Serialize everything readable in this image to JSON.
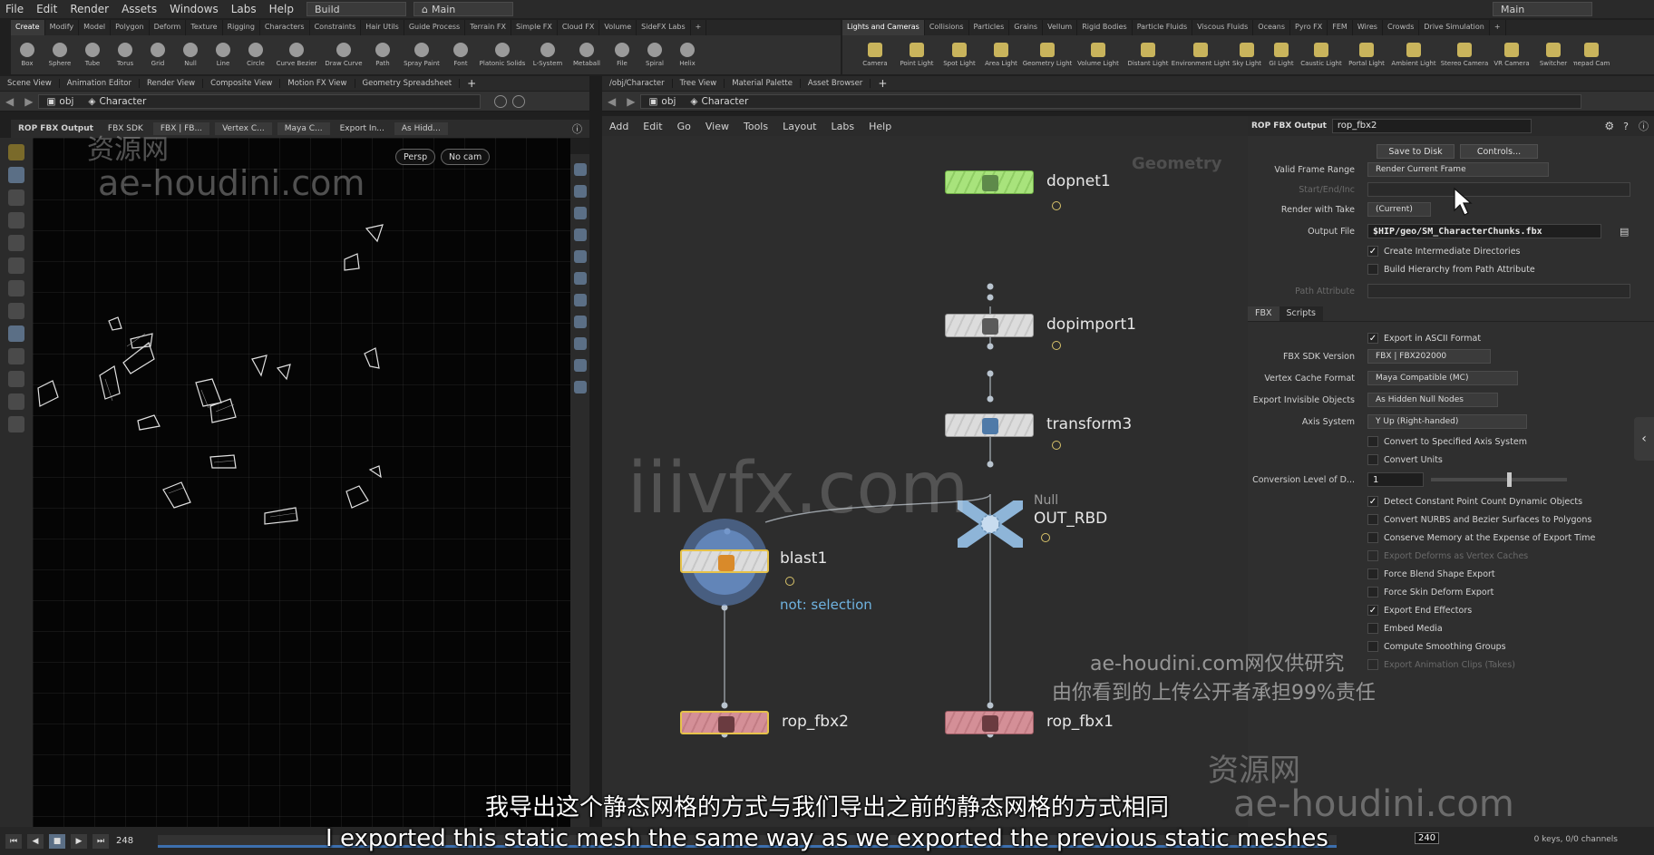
{
  "menubar": {
    "items": [
      "File",
      "Edit",
      "Render",
      "Assets",
      "Windows",
      "Labs",
      "Help"
    ],
    "desktop": "Build",
    "desk_icon": "house-icon",
    "context": "Main",
    "context_right": "Main"
  },
  "shelf_left": {
    "tabs": [
      "Create",
      "Modify",
      "Model",
      "Polygon",
      "Deform",
      "Texture",
      "Rigging",
      "Characters",
      "Constraints",
      "Hair Utils",
      "Guide Process",
      "Terrain FX",
      "Simple FX",
      "Cloud FX",
      "Volume",
      "SideFX Labs",
      "+"
    ],
    "tools": [
      "Box",
      "Sphere",
      "Tube",
      "Torus",
      "Grid",
      "Null",
      "Line",
      "Circle",
      "Curve Bezier",
      "Draw Curve",
      "Path",
      "Spray Paint",
      "Font",
      "Platonic Solids",
      "L-System",
      "Metaball",
      "File",
      "Spiral",
      "Helix"
    ]
  },
  "shelf_right": {
    "tabs": [
      "Lights and Cameras",
      "Collisions",
      "Particles",
      "Grains",
      "Vellum",
      "Rigid Bodies",
      "Particle Fluids",
      "Viscous Fluids",
      "Oceans",
      "Pyro FX",
      "FEM",
      "Wires",
      "Crowds",
      "Drive Simulation",
      "+"
    ],
    "tools": [
      "Camera",
      "Point Light",
      "Spot Light",
      "Area Light",
      "Geometry Light",
      "Volume Light",
      "Distant Light",
      "Environment Light",
      "Sky Light",
      "GI Light",
      "Caustic Light",
      "Portal Light",
      "Ambient Light",
      "Stereo Camera",
      "VR Camera",
      "Switcher",
      "Gamepad Camera"
    ]
  },
  "left_pane": {
    "tabs": [
      "Scene View",
      "Animation Editor",
      "Render View",
      "Composite View",
      "Motion FX View",
      "Geometry Spreadsheet",
      "+"
    ],
    "path": [
      "obj",
      "Character"
    ],
    "toolbar": [
      "ROP FBX Output",
      "FBX SDK",
      "FBX | FB...",
      "Vertex C...",
      "Maya C...",
      "Export In...",
      "As Hidd..."
    ],
    "persp": "Persp",
    "cam": "No cam"
  },
  "right_pane": {
    "tabs": [
      "/obj/Character",
      "Tree View",
      "Material Palette",
      "Asset Browser",
      "+"
    ],
    "path": [
      "obj",
      "Character"
    ],
    "menu": [
      "Add",
      "Edit",
      "Go",
      "View",
      "Tools",
      "Layout",
      "Labs",
      "Help"
    ]
  },
  "network": {
    "context_label": "Geometry",
    "nodes": {
      "dopnet": {
        "name": "dopnet1"
      },
      "dopimport": {
        "name": "dopimport1"
      },
      "transform": {
        "name": "transform3"
      },
      "null": {
        "name": "OUT_RBD",
        "type": "Null"
      },
      "blast": {
        "name": "blast1",
        "note": "not: selection"
      },
      "rop2": {
        "name": "rop_fbx2"
      },
      "rop1": {
        "name": "rop_fbx1"
      }
    }
  },
  "params": {
    "node_type": "ROP FBX Output",
    "node_name": "rop_fbx2",
    "save_to_disk": "Save to Disk",
    "controls": "Controls...",
    "valid_frame_range_label": "Valid Frame Range",
    "valid_frame_range": "Render Current Frame",
    "start_end_label": "Start/End/Inc",
    "render_with_take_label": "Render with Take",
    "render_with_take": "(Current)",
    "output_file_label": "Output File",
    "output_file": "$HIP/geo/SM_CharacterChunks.fbx",
    "create_dirs": "Create Intermediate Directories",
    "build_hierarchy": "Build Hierarchy from Path Attribute",
    "path_attribute_label": "Path Attribute",
    "tabs": [
      "FBX",
      "Scripts"
    ],
    "export_ascii": "Export in ASCII Format",
    "fbx_sdk_label": "FBX SDK Version",
    "fbx_sdk": "FBX | FBX202000",
    "vertex_cache_label": "Vertex Cache Format",
    "vertex_cache": "Maya Compatible (MC)",
    "export_invisible_label": "Export Invisible Objects",
    "export_invisible": "As Hidden Null Nodes",
    "axis_label": "Axis System",
    "axis": "Y Up (Right-handed)",
    "convert_axis": "Convert to Specified Axis System",
    "convert_units": "Convert Units",
    "conversion_label": "Conversion Level of D...",
    "conversion_value": "1",
    "conversion_level": 0.58,
    "detect_constant": "Detect Constant Point Count Dynamic Objects",
    "convert_nurbs": "Convert NURBS and Bezier Surfaces to Polygons",
    "conserve_memory": "Conserve Memory at the Expense of Export Time",
    "export_deforms": "Export Deforms as Vertex Caches",
    "force_blend": "Force Blend Shape Export",
    "force_skin": "Force Skin Deform Export",
    "export_end": "Export End Effectors",
    "embed_media": "Embed Media",
    "compute_smoothing": "Compute Smoothing Groups",
    "export_clips": "Export Animation Clips (Takes)"
  },
  "timeline": {
    "frame": "248",
    "end_frame": "240",
    "keys": "0 keys, 0/0 channels"
  },
  "overlay": {
    "wm_cn_top": "资源网",
    "wm_site_top": "ae-houdini.com",
    "wm_center": "iiivfx.com",
    "wm_notice_1": "ae-houdini.com网仅供研究",
    "wm_notice_2": "由你看到的上传公开者承担99%责任",
    "wm_cn_bottom": "资源网",
    "wm_site_bottom": "ae-houdini.com",
    "subtitle_cn": "我导出这个静态网格的方式与我们导出之前的静态网格的方式相同",
    "subtitle_en": "I exported this static mesh the same way as we exported the previous static meshes"
  },
  "colors": {
    "accent_blue": "#3c6fae",
    "node_green": "#a8e37c",
    "node_pink": "#d48f97",
    "selected_outline": "#e6c24a",
    "note_blue": "#6fb3e0"
  }
}
